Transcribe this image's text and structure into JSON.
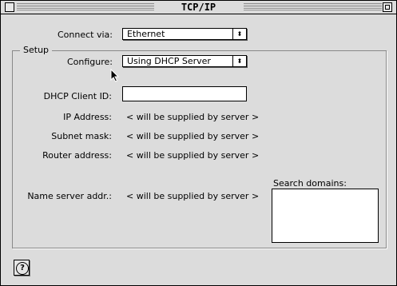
{
  "window": {
    "title": "TCP/IP"
  },
  "connect": {
    "label": "Connect via:",
    "value": "Ethernet"
  },
  "setup": {
    "group_label": "Setup",
    "configure_label": "Configure:",
    "configure_value": "Using DHCP Server",
    "dhcp_label": "DHCP Client ID:",
    "dhcp_value": "",
    "ip_label": "IP Address:",
    "ip_value": "< will be supplied by server >",
    "subnet_label": "Subnet mask:",
    "subnet_value": "< will be supplied by server >",
    "router_label": "Router address:",
    "router_value": "< will be supplied by server >",
    "nameserver_label": "Name server addr.:",
    "nameserver_value": "< will be supplied by server >",
    "search_label": "Search domains:",
    "search_value": ""
  },
  "icons": {
    "close": "close-box",
    "zoom": "zoom-box",
    "popup_arrows": "up-down-arrows",
    "help": "question-mark",
    "cursor": "arrow-pointer"
  }
}
